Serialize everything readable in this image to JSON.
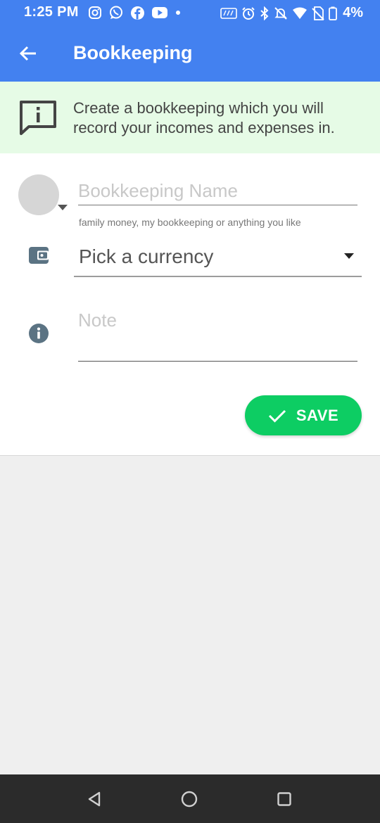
{
  "status_bar": {
    "time": "1:25 PM",
    "battery_text": "4%",
    "left_icons": [
      "instagram-icon",
      "whatsapp-icon",
      "facebook-icon",
      "youtube-icon",
      "dot-icon"
    ],
    "right_icons": [
      "volte-icon",
      "alarm-icon",
      "bluetooth-icon",
      "mute-icon",
      "wifi-icon",
      "no-sim-icon",
      "battery-icon"
    ]
  },
  "app_bar": {
    "title": "Bookkeeping",
    "color": "#4381f0"
  },
  "banner": {
    "text": "Create a bookkeeping which you will record your incomes and expenses in.",
    "background": "#e6fbe6"
  },
  "form": {
    "name_placeholder": "Bookkeeping Name",
    "name_value": "",
    "name_helper": "family money, my bookkeeping or anything you like",
    "currency_label": "Pick a currency",
    "note_placeholder": "Note",
    "note_value": ""
  },
  "save_button": {
    "label": "SAVE",
    "color": "#0dcd63"
  },
  "nav_bar": {
    "icons": [
      "back-triangle-icon",
      "home-circle-icon",
      "recents-square-icon"
    ]
  }
}
